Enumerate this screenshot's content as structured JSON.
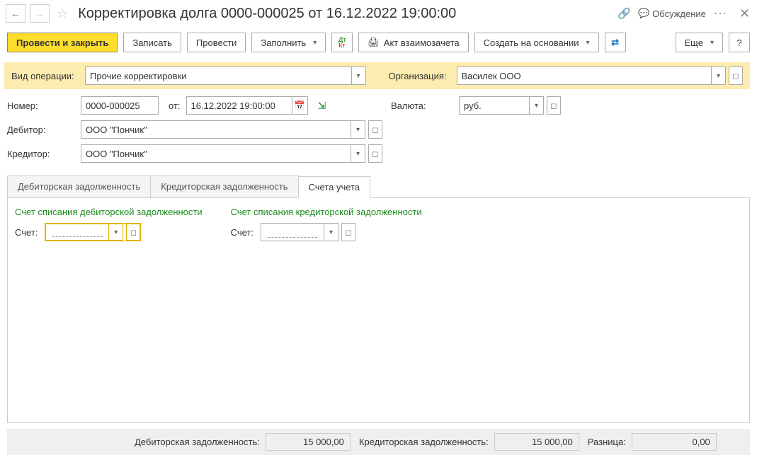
{
  "header": {
    "title": "Корректировка долга 0000-000025 от 16.12.2022 19:00:00",
    "discuss": "Обсуждение"
  },
  "toolbar": {
    "post_close": "Провести и закрыть",
    "save": "Записать",
    "post": "Провести",
    "fill": "Заполнить",
    "act": "Акт взаимозачета",
    "create_based": "Создать на основании",
    "more": "Еще",
    "help": "?"
  },
  "op": {
    "type_label": "Вид операции:",
    "type_value": "Прочие корректировки",
    "org_label": "Организация:",
    "org_value": "Василек ООО"
  },
  "form": {
    "number_label": "Номер:",
    "number_value": "0000-000025",
    "from_label": "от:",
    "date_value": "16.12.2022 19:00:00",
    "currency_label": "Валюта:",
    "currency_value": "руб.",
    "debitor_label": "Дебитор:",
    "debitor_value": "ООО \"Пончик\"",
    "creditor_label": "Кредитор:",
    "creditor_value": "ООО \"Пончик\""
  },
  "tabs": {
    "debit": "Дебиторская задолженность",
    "credit": "Кредиторская задолженность",
    "accounts": "Счета учета"
  },
  "accounts": {
    "debit_title": "Счет списания дебиторской задолженности",
    "credit_title": "Счет списания кредиторской задолженности",
    "account_label": "Счет:"
  },
  "footer": {
    "debit_label": "Дебиторская задолженность:",
    "debit_value": "15 000,00",
    "credit_label": "Кредиторская задолженность:",
    "credit_value": "15 000,00",
    "diff_label": "Разница:",
    "diff_value": "0,00"
  }
}
